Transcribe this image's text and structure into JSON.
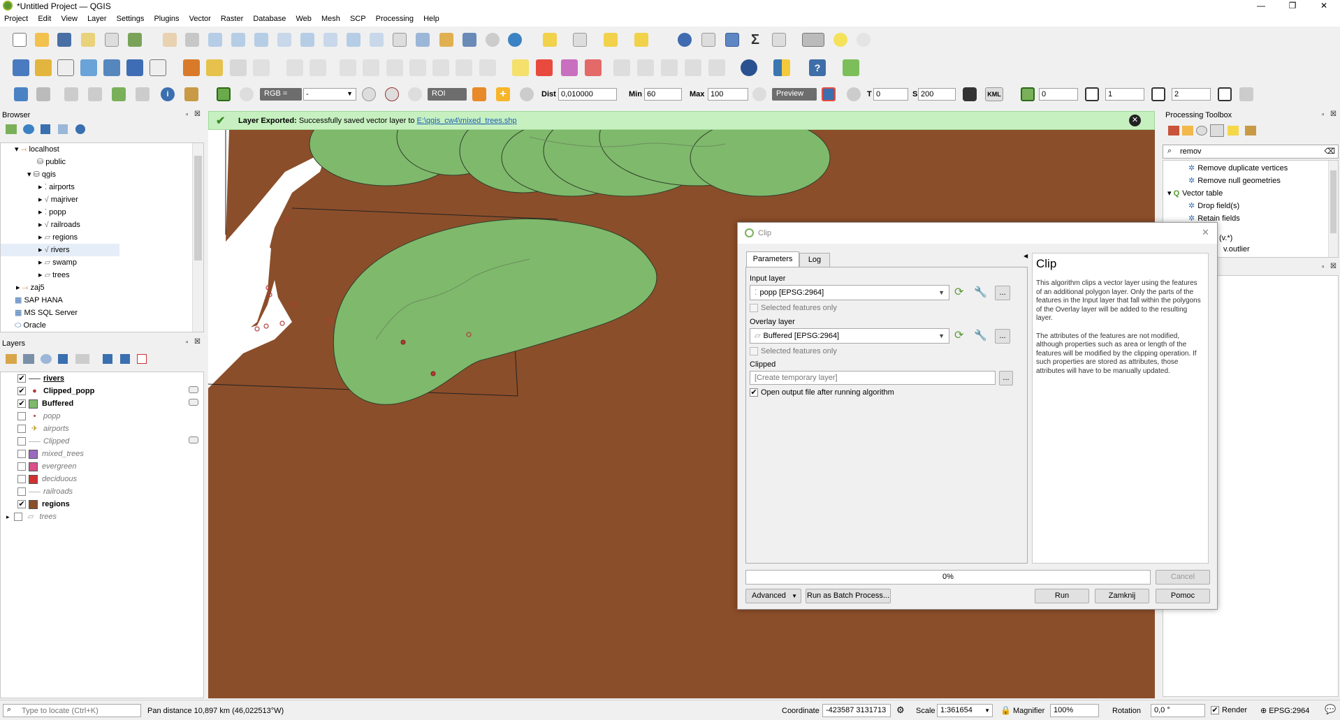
{
  "window": {
    "title": "*Untitled Project — QGIS",
    "controls": [
      "—",
      "❐",
      "✕"
    ]
  },
  "menu": [
    "Project",
    "Edit",
    "View",
    "Layer",
    "Settings",
    "Plugins",
    "Vector",
    "Raster",
    "Database",
    "Web",
    "Mesh",
    "SCP",
    "Processing",
    "Help"
  ],
  "scp_toolbar": {
    "rgb_label": "RGB =",
    "rgb_value": "-",
    "roi_label": "ROI",
    "dist_label": "Dist",
    "dist_value": "0,010000",
    "min_label": "Min",
    "min_value": "60",
    "max_label": "Max",
    "max_value": "100",
    "preview_label": "Preview",
    "t_label": "T",
    "t_value": "0",
    "s_label": "S",
    "s_value": "200",
    "kml_label": "KML",
    "field1": "0",
    "field2": "1",
    "field3": "2"
  },
  "browser": {
    "title": "Browser",
    "items": [
      {
        "label": "localhost",
        "indent": 1
      },
      {
        "label": "public",
        "indent": 2
      },
      {
        "label": "qgis",
        "indent": 2
      },
      {
        "label": "airports",
        "indent": 3
      },
      {
        "label": "majriver",
        "indent": 3
      },
      {
        "label": "popp",
        "indent": 3
      },
      {
        "label": "railroads",
        "indent": 3
      },
      {
        "label": "regions",
        "indent": 3
      },
      {
        "label": "rivers",
        "indent": 3
      },
      {
        "label": "swamp",
        "indent": 3
      },
      {
        "label": "trees",
        "indent": 3
      },
      {
        "label": "zaj5",
        "indent": 1
      },
      {
        "label": "SAP HANA",
        "indent": 0
      },
      {
        "label": "MS SQL Server",
        "indent": 0
      },
      {
        "label": "Oracle",
        "indent": 0
      }
    ]
  },
  "layers": {
    "title": "Layers",
    "items": [
      {
        "label": "rivers",
        "checked": true,
        "style": "bold-underline",
        "symbol": "line"
      },
      {
        "label": "Clipped_popp",
        "checked": true,
        "style": "bold",
        "symbol": "point"
      },
      {
        "label": "Buffered",
        "checked": true,
        "style": "bold",
        "symbol": "fill",
        "color": "#7fb96c"
      },
      {
        "label": "popp",
        "checked": false,
        "style": "italic",
        "symbol": "point"
      },
      {
        "label": "airports",
        "checked": false,
        "style": "italic",
        "symbol": "airport"
      },
      {
        "label": "Clipped",
        "checked": false,
        "style": "italic",
        "symbol": "line"
      },
      {
        "label": "mixed_trees",
        "checked": false,
        "style": "italic",
        "symbol": "fill",
        "color": "#9b6bbf"
      },
      {
        "label": "evergreen",
        "checked": false,
        "style": "italic",
        "symbol": "fill",
        "color": "#d9508a"
      },
      {
        "label": "deciduous",
        "checked": false,
        "style": "italic",
        "symbol": "fill",
        "color": "#d13030"
      },
      {
        "label": "railroads",
        "checked": false,
        "style": "italic",
        "symbol": "line"
      },
      {
        "label": "regions",
        "checked": true,
        "style": "bold",
        "symbol": "fill",
        "color": "#8b4e2a"
      },
      {
        "label": "trees",
        "checked": false,
        "style": "italic",
        "symbol": "group"
      }
    ]
  },
  "message_bar": {
    "title": "Layer Exported:",
    "text": "Successfully saved vector layer to",
    "link": "E:\\qgis_cw4\\mixed_trees.shp"
  },
  "processing": {
    "title": "Processing Toolbox",
    "search": "remov",
    "results": [
      {
        "label": "Remove duplicate vertices",
        "indent": 2
      },
      {
        "label": "Remove null geometries",
        "indent": 2
      },
      {
        "label": "Vector table",
        "indent": 1
      },
      {
        "label": "Drop field(s)",
        "indent": 2
      },
      {
        "label": "Retain fields",
        "indent": 2
      }
    ],
    "partial_rows": [
      "(v.*)",
      "v.outlier"
    ]
  },
  "clip_dialog": {
    "title": "Clip",
    "tabs": [
      "Parameters",
      "Log"
    ],
    "input_layer_label": "Input layer",
    "input_layer_value": "popp [EPSG:2964]",
    "selected_only_1": "Selected features only",
    "overlay_layer_label": "Overlay layer",
    "overlay_layer_value": "Buffered [EPSG:2964]",
    "selected_only_2": "Selected features only",
    "clipped_label": "Clipped",
    "clipped_placeholder": "[Create temporary layer]",
    "open_output_label": "Open output file after running algorithm",
    "ellipsis": "...",
    "help_title": "Clip",
    "help_p1": "This algorithm clips a vector layer using the features of an additional polygon layer. Only the parts of the features in the Input layer that fall within the polygons of the Overlay layer will be added to the resulting layer.",
    "help_p2": "The attributes of the features are not modified, although properties such as area or length of the features will be modified by the clipping operation. If such properties are stored as attributes, those attributes will have to be manually updated.",
    "progress": "0%",
    "progress_value": 0,
    "cancel": "Cancel",
    "advanced": "Advanced",
    "batch": "Run as Batch Process...",
    "run": "Run",
    "close": "Zamknij",
    "help": "Pomoc"
  },
  "statusbar": {
    "locate_placeholder": "Type to locate (Ctrl+K)",
    "message": "Pan distance 10,897 km (46,022513°W)",
    "coordinate_label": "Coordinate",
    "coordinate": "-423587  3131713",
    "scale_label": "Scale",
    "scale": "1:361654",
    "magnifier_label": "Magnifier",
    "magnifier": "100%",
    "rotation_label": "Rotation",
    "rotation": "0,0 °",
    "render_label": "Render",
    "crs": "EPSG:2964"
  },
  "colors": {
    "map_background": "#8b4e2a",
    "buffer_fill": "#7fb96c",
    "message_bg": "#c7f0c0"
  }
}
